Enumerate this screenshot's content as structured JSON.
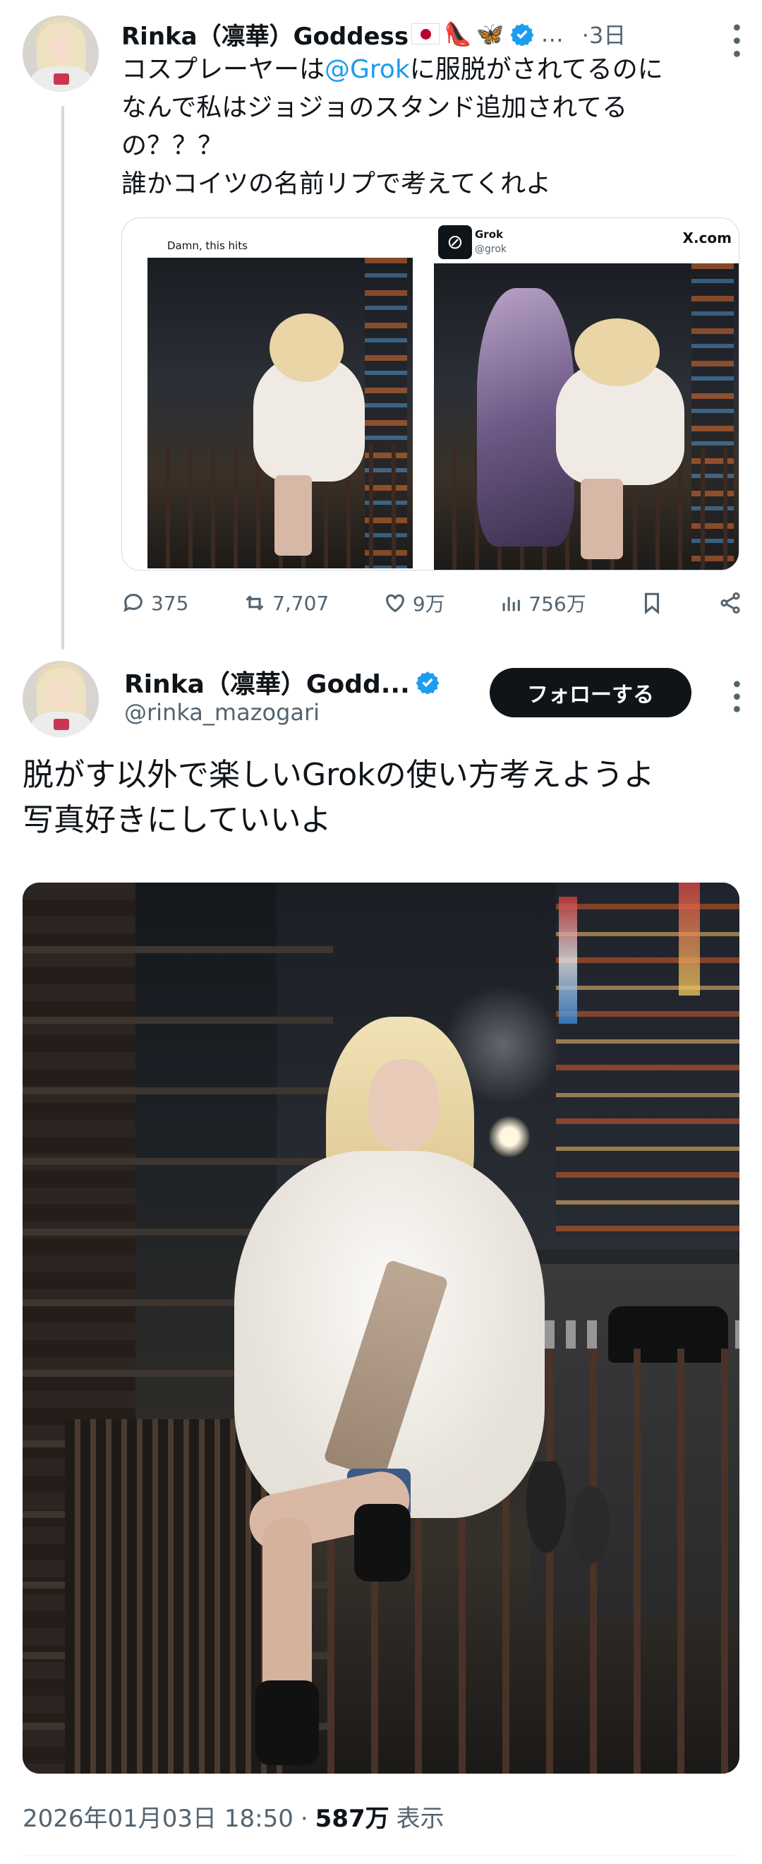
{
  "tweet1": {
    "display_name": "Rinka（凛華）Goddess",
    "emojis": [
      "👠",
      "🦋"
    ],
    "ellipsis": "…",
    "time": "·3日",
    "text_prefix": "コスプレーヤーは",
    "mention": "@Grok",
    "text_suffix": "に服脱がされてるのに\nなんで私はジョジョのスタンド追加されてる\nの？？？\n誰かコイツの名前リプで考えてくれよ",
    "media": {
      "left_caption": "Damn, this hits",
      "right_name": "Grok",
      "right_handle": "@grok",
      "right_site": "X.com"
    },
    "actions": {
      "replies": "375",
      "reposts": "7,707",
      "likes": "9万",
      "views": "756万"
    }
  },
  "tweet2": {
    "display_name": "Rinka（凛華）Godd...",
    "handle": "@rinka_mazogari",
    "follow_label": "フォローする",
    "text": "脱がす以外で楽しいGrokの使い方考えようよ\n写真好きにしていいよ",
    "timestamp": "2026年01月03日 18:50",
    "separator": "·",
    "views_count": "587万",
    "views_label": "表示"
  },
  "colors": {
    "accent": "#1d9bf0",
    "text": "#0f1419",
    "muted": "#536471",
    "follow_bg": "#0f1419"
  }
}
